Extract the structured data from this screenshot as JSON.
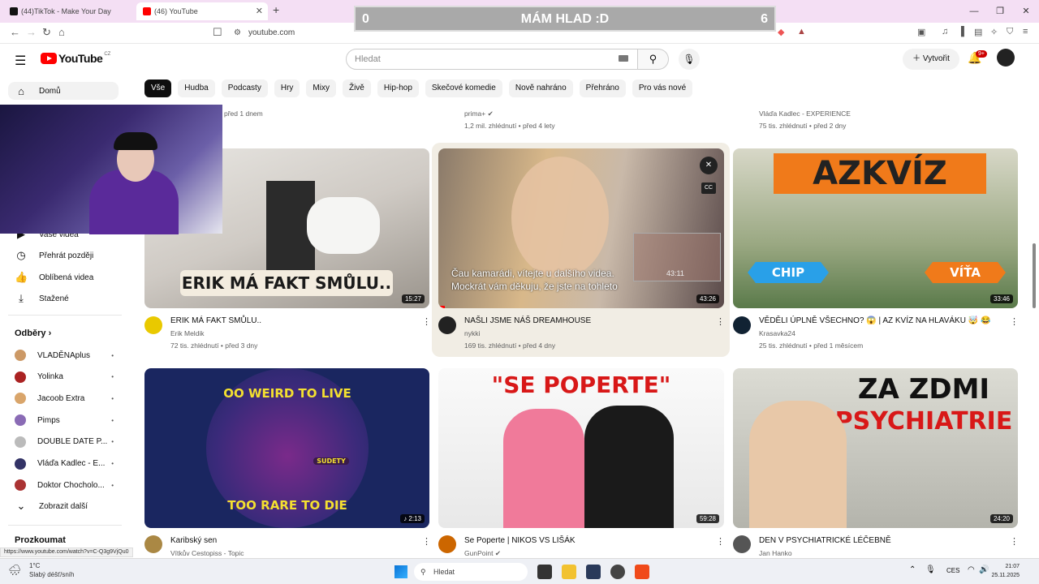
{
  "browser": {
    "tabs": [
      {
        "label": "(44)TikTok - Make Your Day"
      },
      {
        "label": "(46) YouTube"
      }
    ],
    "url": "youtube.com",
    "status_url": "https://www.youtube.com/watch?v=C-Q3g9VjQu0"
  },
  "overlay": {
    "left_score": "0",
    "title": "MÁM HLAD :D",
    "right_score": "6"
  },
  "youtube": {
    "logo": "YouTube",
    "region": "CZ",
    "search_placeholder": "Hledat",
    "create_label": "Vytvořit",
    "notif_badge": "9+"
  },
  "chips": [
    "Vše",
    "Hudba",
    "Podcasty",
    "Hry",
    "Mixy",
    "Živě",
    "Hip-hop",
    "Skečové komedie",
    "Nově nahráno",
    "Přehráno",
    "Pro vás nové"
  ],
  "sidebar": {
    "home": "Domů",
    "items": [
      {
        "label": "Vaše videa",
        "icon": "play-square-icon"
      },
      {
        "label": "Přehrát později",
        "icon": "clock-icon"
      },
      {
        "label": "Oblíbená videa",
        "icon": "thumb-up-icon"
      },
      {
        "label": "Stažené",
        "icon": "download-icon"
      }
    ],
    "subs_header": "Odběry",
    "subs": [
      {
        "name": "VLADĚNAplus",
        "color": "#c96"
      },
      {
        "name": "Yolinka",
        "color": "#a22"
      },
      {
        "name": "Jacoob Extra",
        "color": "#d9a56b"
      },
      {
        "name": "Pimps",
        "color": "#8a6bb5"
      },
      {
        "name": "DOUBLE DATE P...",
        "color": "#bbb"
      },
      {
        "name": "Vláďa Kadlec - E...",
        "color": "#336"
      },
      {
        "name": "Doktor Chocholo...",
        "color": "#a33"
      }
    ],
    "show_more": "Zobrazit další",
    "explore": "Prozkoumat"
  },
  "top_row": [
    {
      "meta": "před 1 dnem"
    },
    {
      "channel": "prima+",
      "meta": "1,2 mil. zhlédnutí • před 4 lety"
    },
    {
      "channel": "Vláďa Kadlec - EXPERIENCE",
      "meta": "75 tis. zhlédnutí • před 2 dny"
    }
  ],
  "videos": [
    {
      "title": "ERIK MÁ FAKT SMŮLU..",
      "channel": "Erik Meldik",
      "meta": "72 tis. zhlédnutí • před 3 dny",
      "duration": "15:27",
      "thumb_text": "ERIK MÁ FAKT SMŮLU.."
    },
    {
      "title": "NAŠLI JSME NÁŠ DREAMHOUSE",
      "channel": "nykki",
      "meta": "169 tis. zhlédnutí • před 4 dny",
      "duration": "43:26",
      "caption1": "Čau kamarádi, vítejte u dalšího videa.",
      "caption2": "Mockrát vám děkuju, že jste na tohleto",
      "preview_time": "43:11"
    },
    {
      "title": "VĚDĚLI ÚPLNĚ VŠECHNO? 😱 | AZ KVÍZ NA HLAVÁKU 🤯 😂",
      "channel": "Krasavka24",
      "meta": "25 tis. zhlédnutí • před 1 měsícem",
      "duration": "33:46",
      "thumb_text": "AZKVÍZ",
      "left_label": "CHIP",
      "right_label": "VÍŤA"
    },
    {
      "title": "Karibský sen",
      "channel": "Vítkův Cestopiss - Topic",
      "duration": "♪ 2:13",
      "thumb_top": "OO WEIRD TO LIVE",
      "thumb_bottom": "TOO RARE TO DIE",
      "thumb_sign": "SUDETY"
    },
    {
      "title": "Se Poperte | NIKOS VS LIŠÁK",
      "channel": "GunPoint",
      "duration": "59:28",
      "thumb_text": "\"SE POPERTE\""
    },
    {
      "title": "DEN V PSYCHIATRICKÉ LÉČEBNĚ",
      "channel": "Jan Hanko",
      "duration": "24:20",
      "thumb_line1": "ZA ZDMI",
      "thumb_line2": "PSYCHIATRIE"
    }
  ],
  "taskbar": {
    "temp": "1°C",
    "weather": "Slabý déšť/sníh",
    "search": "Hledat",
    "lang": "CES",
    "time": "21:07",
    "date": "25.11.2025"
  }
}
